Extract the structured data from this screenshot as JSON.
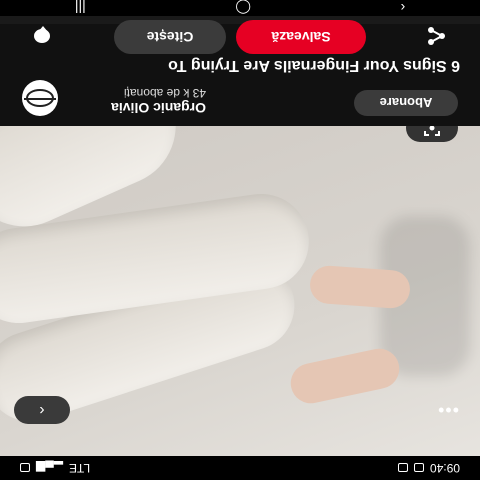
{
  "status": {
    "time": "09:40",
    "signal_text": "LTE"
  },
  "pin": {
    "title": "6 Signs Your Fingernails Are Trying To",
    "channel_name": "Organic Olivia",
    "channel_subscribers": "43 k de abonați",
    "subscribe_label": "Abonare",
    "save_label": "Salvează",
    "read_label": "Citește"
  },
  "icons": {
    "back": "‹",
    "more": "•••",
    "lens": "lens-icon",
    "share": "share-icon",
    "comment": "comment-icon"
  },
  "navbar": {
    "recent": "|||",
    "home": "◯",
    "back": "‹"
  }
}
